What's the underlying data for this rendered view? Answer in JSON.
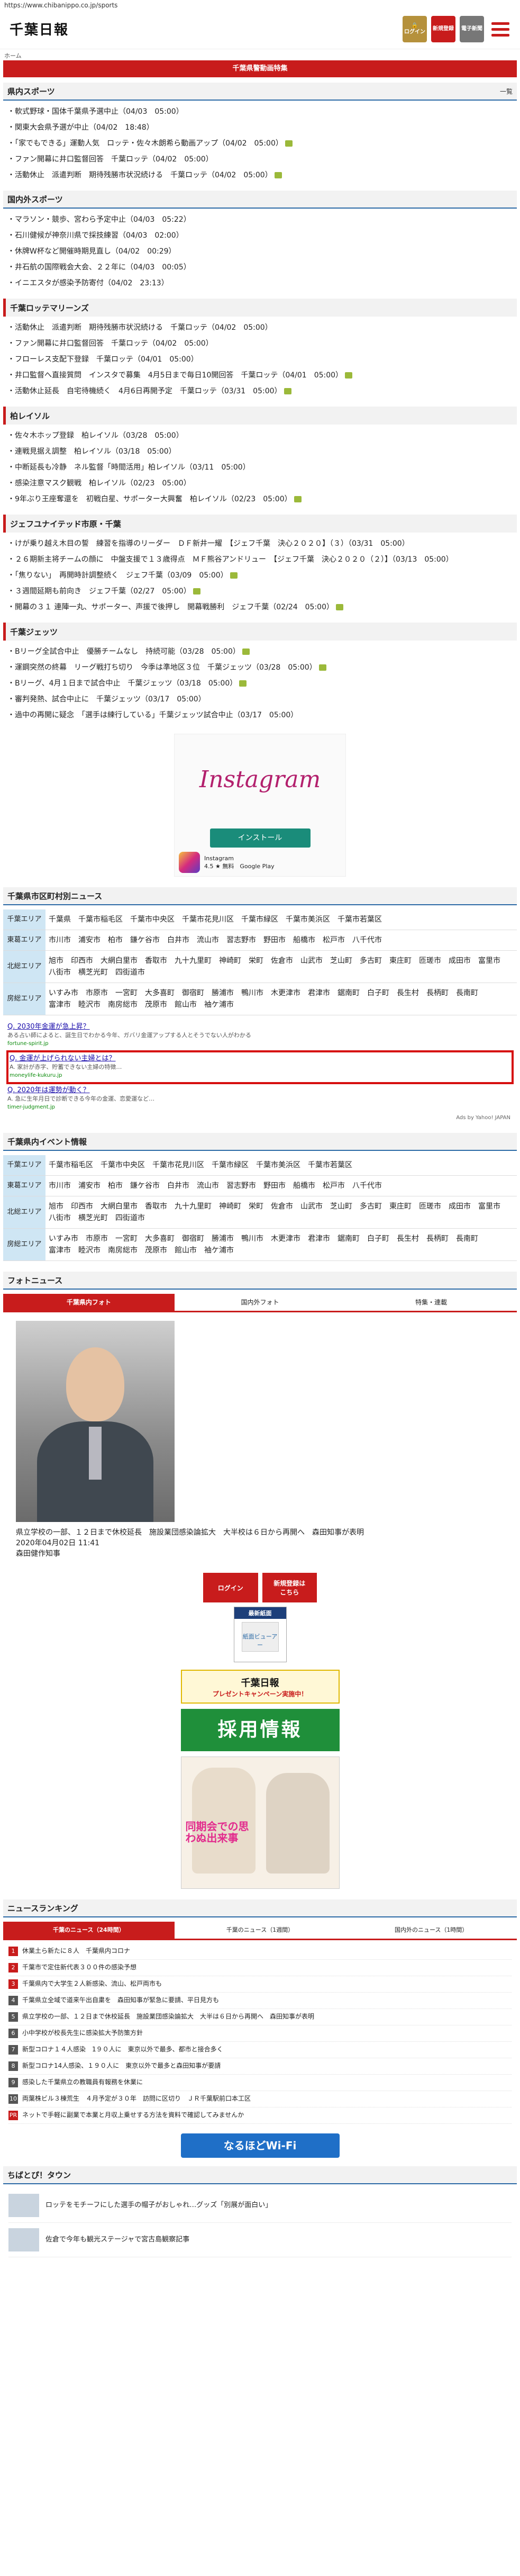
{
  "url": "https://www.chibanippo.co.jp/sports",
  "header": {
    "logo": "千葉日報",
    "login_label": "ログイン",
    "register_label": "新規登録",
    "paper_label": "電子新聞"
  },
  "breadcrumb": "ホーム",
  "banner_red": "千葉県警動画特集",
  "sports": {
    "title": "県内スポーツ",
    "more": "一覧",
    "items": [
      "軟式野球・国体千葉県予選中止（04/03　05:00）",
      "関東大会県予選が中止（04/02　18:48）",
      "「家でもできる」運動人気　ロッテ・佐々木朗希ら動画アップ（04/02　05:00）",
      "ファン開幕に井口監督回答　千葉ロッテ（04/02　05:00）",
      "活動休止　派遣判断　期待残勝市状況続ける　千葉ロッテ（04/02　05:00）"
    ]
  },
  "domestic": {
    "title": "国内外スポーツ",
    "items": [
      "マラソン・競歩、宮わら予定中止（04/03　05:22）",
      "石川健候が神奈川県で採技練習（04/03　02:00）",
      "休牌W杯など開催時期見直し（04/02　00:29）",
      "井石航の国際戦会大会、２２年に（04/03　00:05）",
      "イニエスタが感染予防寄付（04/02　23:13）"
    ]
  },
  "marines": {
    "title": "千葉ロッテマリーンズ",
    "items": [
      "活動休止　派遣判断　期待残勝市状況続ける　千葉ロッテ（04/02　05:00）",
      "ファン開幕に井口監督回答　千葉ロッテ（04/02　05:00）",
      "フローレス支配下登録　千葉ロッテ（04/01　05:00）",
      "井口監督へ直接質問　インスタで募集　4月5日まで毎日10開回答　千葉ロッテ（04/01　05:00）",
      "活動休止延長　自宅待機続く　4月6日再開予定　千葉ロッテ（03/31　05:00）"
    ]
  },
  "reysol": {
    "title": "柏レイソル",
    "items": [
      "佐々木ホップ登録　柏レイソル（03/28　05:00）",
      "連戦見据え調整　柏レイソル（03/18　05:00）",
      "中断延長も冷静　ネル監督「時間活用」柏レイソル（03/11　05:00）",
      "感染注意マスク観戦　柏レイソル（02/23　05:00）",
      "9年ぶり王座奪還を　初戦白星、サポーター大興奮　柏レイソル（02/23　05:00）"
    ]
  },
  "jets": {
    "title": "ジェフユナイテッド市原・千葉",
    "items": [
      "けが乗り越え木目の誓　練習を指導のリーダー　ＤＦ新井一耀　【ジェフ千葉　決心２０２０】（３）（03/31　05:00）",
      "２６期新主将チームの顔に　中盤支援で１３歳得点　ＭＦ熊谷アンドリュー　【ジェフ千葉　決心２０２０（２）】（03/13　05:00）",
      "「焦りない」　再開時計調整続く　ジェフ千葉（03/09　05:00）",
      "３週間延期も前向き　ジェフ千葉（02/27　05:00）",
      "開幕の３１ 連陣一丸、サポーター、声援で後押し　開幕戦勝利　ジェフ千葉（02/24　05:00）"
    ]
  },
  "chibajets": {
    "title": "千葉ジェッツ",
    "items": [
      "Bリーグ全試合中止　優勝チームなし　持続可能（03/28　05:00）",
      "運鋼突然の終幕　リーグ戦打ち切り　今季は準地区３位　千葉ジェッツ（03/28　05:00）",
      "Bリーグ、4月１日まで試合中止　千葉ジェッツ（03/18　05:00）",
      "審判発熱、試合中止に　千葉ジェッツ（03/17　05:00）",
      "過中の再開に疑念　「選手は練行している」千葉ジェッツ試合中止（03/17　05:00）"
    ]
  },
  "ad": {
    "brand": "Instagram",
    "install_label": "インストール",
    "app_name": "Instagram",
    "rating": "4.5 ★ 無料",
    "store": "Google Play"
  },
  "city_news": {
    "title": "千葉県市区町村別ニュース",
    "rows": [
      {
        "label": "千葉エリア",
        "towns": [
          "千葉県",
          "千葉市稲毛区",
          "千葉市中央区",
          "千葉市花見川区",
          "千葉市緑区",
          "千葉市美浜区",
          "千葉市若葉区"
        ]
      },
      {
        "label": "東葛エリア",
        "towns": [
          "市川市",
          "浦安市",
          "柏市",
          "鎌ケ谷市",
          "白井市",
          "流山市",
          "習志野市",
          "野田市",
          "船橋市",
          "松戸市",
          "八千代市"
        ]
      },
      {
        "label": "北総エリア",
        "towns": [
          "旭市",
          "印西市",
          "大網白里市",
          "香取市",
          "九十九里町",
          "神崎町",
          "栄町",
          "佐倉市",
          "山武市",
          "芝山町",
          "多古町",
          "東庄町",
          "匝瑳市",
          "成田市",
          "富里市",
          "八街市",
          "横芝光町",
          "四街道市"
        ]
      },
      {
        "label": "房総エリア",
        "towns": [
          "いすみ市",
          "市原市",
          "一宮町",
          "大多喜町",
          "御宿町",
          "勝浦市",
          "鴨川市",
          "木更津市",
          "君津市",
          "鋸南町",
          "白子町",
          "長生村",
          "長柄町",
          "長南町",
          "富津市",
          "睦沢市",
          "南房総市",
          "茂原市",
          "館山市",
          "袖ケ浦市"
        ]
      }
    ]
  },
  "yahoo_links": [
    {
      "title": "Q. 2030年金運が急上昇？",
      "desc": "ある占い師によると、誕生日でわかる今年、ガバリ金運アップする人とそうでない人がわかる",
      "url": "fortune-spirit.jp"
    },
    {
      "title": "Q. 金運が上げられない主婦とは？",
      "desc": "A. 家計が赤字、貯蓄できない主婦の特徴…",
      "url": "moneylife-kukuru.jp"
    },
    {
      "title": "Q. 2020年は運勢が動く？",
      "desc": "A. 急に生年月日で診断できる今年の金運、恋愛運など…",
      "url": "timer-judgment.jp"
    }
  ],
  "yahoo_credit": "Ads by Yahoo! JAPAN",
  "events": {
    "title": "千葉県内イベント情報",
    "rows": [
      {
        "label": "千葉エリア",
        "towns": [
          "千葉市稲毛区",
          "千葉市中央区",
          "千葉市花見川区",
          "千葉市緑区",
          "千葉市美浜区",
          "千葉市若葉区"
        ]
      },
      {
        "label": "東葛エリア",
        "towns": [
          "市川市",
          "浦安市",
          "柏市",
          "鎌ケ谷市",
          "白井市",
          "流山市",
          "習志野市",
          "野田市",
          "船橋市",
          "松戸市",
          "八千代市"
        ]
      },
      {
        "label": "北総エリア",
        "towns": [
          "旭市",
          "印西市",
          "大網白里市",
          "香取市",
          "九十九里町",
          "神崎町",
          "栄町",
          "佐倉市",
          "山武市",
          "芝山町",
          "多古町",
          "東庄町",
          "匝瑳市",
          "成田市",
          "富里市",
          "八街市",
          "横芝光町",
          "四街道市"
        ]
      },
      {
        "label": "房総エリア",
        "towns": [
          "いすみ市",
          "市原市",
          "一宮町",
          "大多喜町",
          "御宿町",
          "勝浦市",
          "鴨川市",
          "木更津市",
          "君津市",
          "鋸南町",
          "白子町",
          "長生村",
          "長柄町",
          "長南町",
          "富津市",
          "睦沢市",
          "南房総市",
          "茂原市",
          "館山市",
          "袖ケ浦市"
        ]
      }
    ]
  },
  "photo_news": {
    "title": "フォトニュース",
    "tabs": [
      "千葉県内フォト",
      "国内外フォト",
      "特集・連載"
    ],
    "caption": "県立学校の一部、１２日まで休校延長　施設業団感染論拡大　大半校は６日から再開へ　森田知事が表明",
    "date": "2020年04月02日 11:41",
    "credit": "森田健作知事"
  },
  "side": {
    "login": "ログイン",
    "register": "新規登録は\nこちら",
    "latest_title": "最新紙面",
    "latest_link": "紙面ビューアー",
    "banner1_logo": "千葉日報",
    "banner1_text": "プレゼントキャンペーン実施中！",
    "banner2": "採用情報",
    "manga_text": "同期会での思わぬ出来事"
  },
  "ranking": {
    "title": "ニュースランキング",
    "tabs": [
      "千葉のニュース（24時間）",
      "千葉のニュース（1週間）",
      "国内外のニュース（1時間）"
    ],
    "items": [
      "休業土ら新たに８人　千葉県内コロナ",
      "千葉市で定住新代表３００件の感染予想",
      "千葉県内で大学生２人新感染、流山、松戸両市も",
      "千葉県立全域で道来午出自粛を　森田知事が緊急に要請、平日見方も",
      "県立学校の一部、１２日まで休校延長　施設業団感染論拡大　大半は６日から再開へ　森田知事が表明",
      "小中学校が校長先生に感染拡大予防策方針",
      "新型コロナ１４人感染　1９０人に　東京以外で最多、都市と接合多く",
      "新型コロナ14人感染、１９０人に　東京以外で最多と森田知事が要請",
      "感染した千葉県立の教職員有報務を休業に",
      "両葉株ビル３棟荒生　４月予定が３０年　訪問に区切り　ＪＲ千葉駅前口本工区"
    ],
    "extra": "ネットで手軽に副業で本業と月収上乗せする方法を資料で確認してみませんか"
  },
  "wifi_banner": "なるほどWi-Fi",
  "town": {
    "title": "ちばとぴ！タウン",
    "items": [
      "ロッテをモチーフにした選手の帽子がおしゃれ…グッズ「別展が面白い」",
      "佐倉で今年も観光ステージャで宮古島観察記事"
    ]
  }
}
